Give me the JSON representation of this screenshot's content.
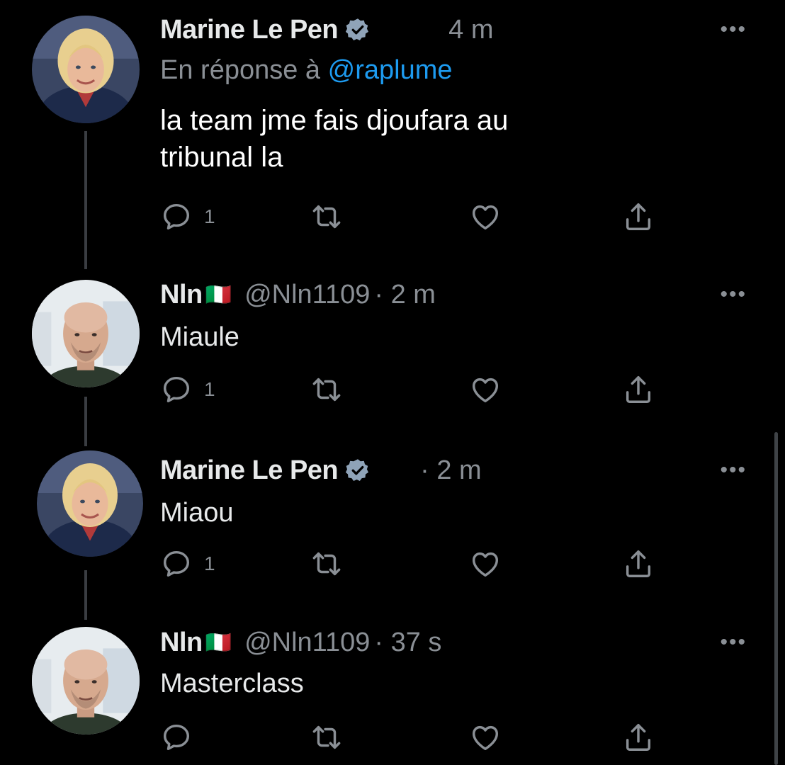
{
  "colors": {
    "background": "#000000",
    "text": "#e7e9ea",
    "muted": "#8a8f95",
    "link": "#1d9bf0",
    "verified": "#8fa3b8"
  },
  "icons": {
    "reply": "reply-icon",
    "retweet": "retweet-icon",
    "like": "heart-icon",
    "share": "share-icon",
    "more": "more-icon",
    "verified": "verified-badge-icon"
  },
  "tweets": [
    {
      "name": "Marine Le Pen",
      "verified": true,
      "handle": "",
      "time": "4 m",
      "reply_prefix": "En réponse à",
      "reply_to": "@raplume",
      "text_line1": "la team jme fais djoufara au",
      "text_line2": "tribunal la",
      "reply_count": "1",
      "more": "•••"
    },
    {
      "name": "Nln",
      "flag": "🇮🇹",
      "verified": false,
      "handle": "@Nln1109",
      "time": "· 2 m",
      "text": "Miaule",
      "reply_count": "1",
      "more": "•••"
    },
    {
      "name": "Marine Le Pen",
      "verified": true,
      "handle": "",
      "time": "· 2 m",
      "text": "Miaou",
      "reply_count": "1",
      "more": "•••"
    },
    {
      "name": "Nln",
      "flag": "🇮🇹",
      "verified": false,
      "handle": "@Nln1109",
      "time": "· 37 s",
      "text": "Masterclass",
      "reply_count": "",
      "more": "•••"
    }
  ]
}
